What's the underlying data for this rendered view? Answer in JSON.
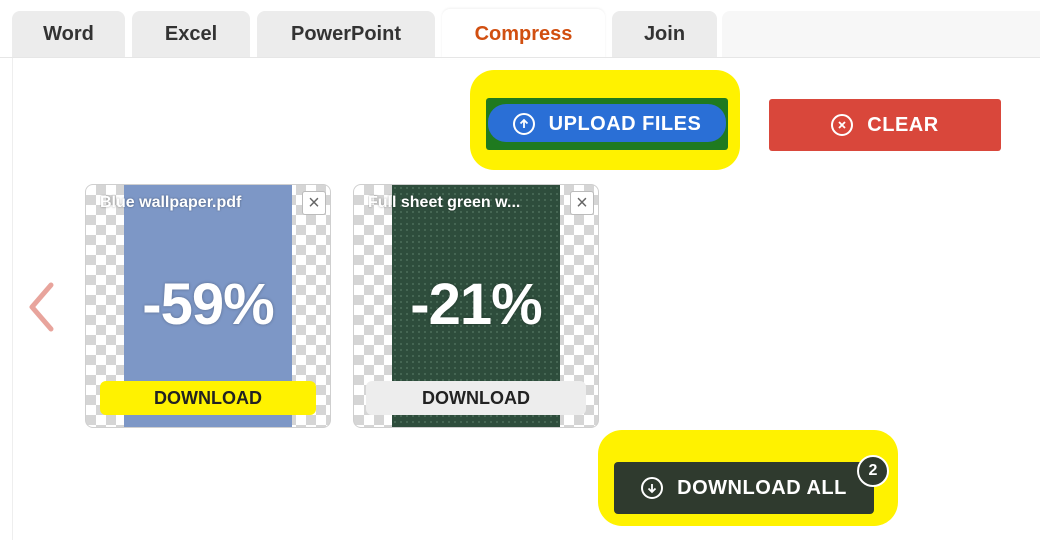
{
  "tabs": [
    {
      "label": "Word"
    },
    {
      "label": "Excel"
    },
    {
      "label": "PowerPoint"
    },
    {
      "label": "Compress",
      "active": true
    },
    {
      "label": "Join"
    }
  ],
  "toolbar": {
    "upload_label": "UPLOAD FILES",
    "clear_label": "CLEAR"
  },
  "files": [
    {
      "name": "Blue wallpaper.pdf",
      "reduction": "-59%",
      "download_label": "DOWNLOAD"
    },
    {
      "name": "Full sheet green w...",
      "reduction": "-21%",
      "download_label": "DOWNLOAD"
    }
  ],
  "download_all": {
    "label": "DOWNLOAD ALL",
    "count": "2"
  },
  "icons": {
    "upload": "arrow-up-circle-icon",
    "clear": "x-circle-icon",
    "download_all": "arrow-down-circle-icon",
    "close": "close-icon",
    "prev": "chevron-left-icon"
  },
  "colors": {
    "accent_tab": "#d14f10",
    "upload": "#2a6fd6",
    "clear": "#d9473b",
    "download_all": "#2f3a2e",
    "highlight": "#fff200"
  }
}
